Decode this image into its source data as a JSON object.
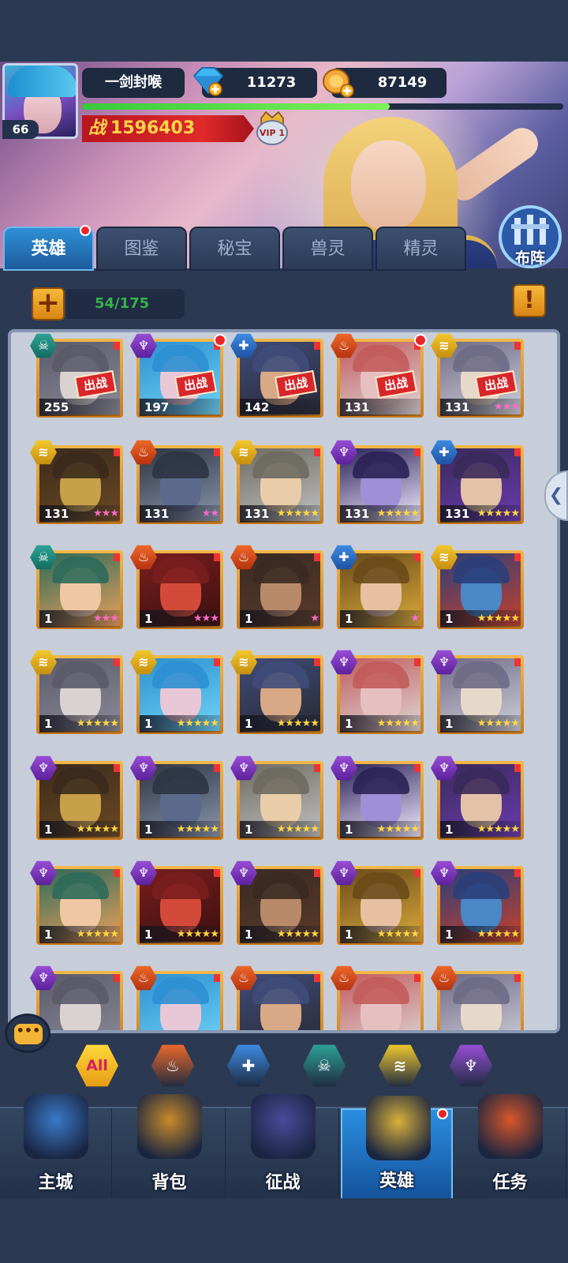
{
  "player": {
    "name": "一剑封喉",
    "level": "66",
    "gems": "11273",
    "gold": "87149",
    "power_prefix": "战",
    "power": "1596403",
    "vip": "VIP 1",
    "xp_fraction": 0.64
  },
  "formation_label": "布阵",
  "tabs": [
    {
      "label": "英雄",
      "active": true,
      "badge": true
    },
    {
      "label": "图鉴"
    },
    {
      "label": "秘宝"
    },
    {
      "label": "兽灵"
    },
    {
      "label": "精灵"
    }
  ],
  "roster": {
    "count": "54/175"
  },
  "deploy_label": "出战",
  "heroes": [
    {
      "element": "dark",
      "level": "255",
      "deployed": true,
      "stars": 0,
      "star_color": "pink",
      "dot": false
    },
    {
      "element": "purple",
      "level": "197",
      "deployed": true,
      "stars": 0,
      "star_color": "pink",
      "dot": true
    },
    {
      "element": "blue",
      "level": "142",
      "deployed": true,
      "stars": 0,
      "star_color": "pink",
      "dot": false
    },
    {
      "element": "fire",
      "level": "131",
      "deployed": true,
      "stars": 0,
      "star_color": "pink",
      "dot": true
    },
    {
      "element": "gold",
      "level": "131",
      "deployed": true,
      "stars": 3,
      "star_color": "pink",
      "dot": false
    },
    {
      "element": "gold",
      "level": "131",
      "deployed": false,
      "stars": 3,
      "star_color": "pink",
      "dot": false
    },
    {
      "element": "fire",
      "level": "131",
      "deployed": false,
      "stars": 2,
      "star_color": "pink",
      "dot": false
    },
    {
      "element": "gold",
      "level": "131",
      "deployed": false,
      "stars": 5,
      "star_color": "gold",
      "dot": false
    },
    {
      "element": "purple",
      "level": "131",
      "deployed": false,
      "stars": 5,
      "star_color": "gold",
      "dot": false
    },
    {
      "element": "blue",
      "level": "131",
      "deployed": false,
      "stars": 5,
      "star_color": "gold",
      "dot": false
    },
    {
      "element": "dark",
      "level": "1",
      "deployed": false,
      "stars": 3,
      "star_color": "pink",
      "dot": false
    },
    {
      "element": "fire",
      "level": "1",
      "deployed": false,
      "stars": 3,
      "star_color": "pink",
      "dot": false
    },
    {
      "element": "fire",
      "level": "1",
      "deployed": false,
      "stars": 1,
      "star_color": "pink",
      "dot": false
    },
    {
      "element": "blue",
      "level": "1",
      "deployed": false,
      "stars": 1,
      "star_color": "pink",
      "dot": false
    },
    {
      "element": "gold",
      "level": "1",
      "deployed": false,
      "stars": 5,
      "star_color": "gold",
      "dot": false
    },
    {
      "element": "gold",
      "level": "1",
      "deployed": false,
      "stars": 5,
      "star_color": "gold",
      "dot": false
    },
    {
      "element": "gold",
      "level": "1",
      "deployed": false,
      "stars": 5,
      "star_color": "gold",
      "dot": false
    },
    {
      "element": "gold",
      "level": "1",
      "deployed": false,
      "stars": 5,
      "star_color": "gold",
      "dot": false
    },
    {
      "element": "purple",
      "level": "1",
      "deployed": false,
      "stars": 5,
      "star_color": "gold",
      "dot": false
    },
    {
      "element": "purple",
      "level": "1",
      "deployed": false,
      "stars": 5,
      "star_color": "gold",
      "dot": false
    },
    {
      "element": "purple",
      "level": "1",
      "deployed": false,
      "stars": 5,
      "star_color": "gold",
      "dot": false
    },
    {
      "element": "purple",
      "level": "1",
      "deployed": false,
      "stars": 5,
      "star_color": "gold",
      "dot": false
    },
    {
      "element": "purple",
      "level": "1",
      "deployed": false,
      "stars": 5,
      "star_color": "gold",
      "dot": false
    },
    {
      "element": "purple",
      "level": "1",
      "deployed": false,
      "stars": 5,
      "star_color": "gold",
      "dot": false
    },
    {
      "element": "purple",
      "level": "1",
      "deployed": false,
      "stars": 5,
      "star_color": "gold",
      "dot": false
    },
    {
      "element": "purple",
      "level": "1",
      "deployed": false,
      "stars": 5,
      "star_color": "gold",
      "dot": false
    },
    {
      "element": "purple",
      "level": "1",
      "deployed": false,
      "stars": 5,
      "star_color": "gold",
      "dot": false
    },
    {
      "element": "purple",
      "level": "1",
      "deployed": false,
      "stars": 5,
      "star_color": "gold",
      "dot": false
    },
    {
      "element": "purple",
      "level": "1",
      "deployed": false,
      "stars": 5,
      "star_color": "gold",
      "dot": false
    },
    {
      "element": "purple",
      "level": "1",
      "deployed": false,
      "stars": 5,
      "star_color": "gold",
      "dot": false
    },
    {
      "element": "purple",
      "level": "",
      "deployed": false,
      "stars": 0,
      "star_color": "gold",
      "dot": false
    },
    {
      "element": "fire",
      "level": "",
      "deployed": false,
      "stars": 0,
      "star_color": "gold",
      "dot": false
    },
    {
      "element": "fire",
      "level": "",
      "deployed": false,
      "stars": 0,
      "star_color": "gold",
      "dot": false
    },
    {
      "element": "fire",
      "level": "",
      "deployed": false,
      "stars": 0,
      "star_color": "gold",
      "dot": false
    },
    {
      "element": "fire",
      "level": "",
      "deployed": false,
      "stars": 0,
      "star_color": "gold",
      "dot": false
    }
  ],
  "element_colors": {
    "dark": "#2ea59a",
    "purple": "#9b4fd8",
    "blue": "#3d8ee6",
    "fire": "#f06a2a",
    "gold": "#f5cb2e"
  },
  "filters": [
    {
      "label": "All",
      "icon": "all-filter-icon"
    },
    {
      "label": "",
      "icon": "fire-element-icon",
      "element": "fire"
    },
    {
      "label": "",
      "icon": "blue-cross-element-icon",
      "element": "blue"
    },
    {
      "label": "",
      "icon": "skull-element-icon",
      "element": "dark"
    },
    {
      "label": "",
      "icon": "wind-element-icon",
      "element": "gold"
    },
    {
      "label": "",
      "icon": "trident-element-icon",
      "element": "purple"
    }
  ],
  "nav": [
    {
      "label": "主城",
      "icon": "castle-icon"
    },
    {
      "label": "背包",
      "icon": "treasure-chest-icon"
    },
    {
      "label": "征战",
      "icon": "dragon-portal-icon"
    },
    {
      "label": "英雄",
      "icon": "hero-helmet-icon",
      "active": true,
      "badge": true
    },
    {
      "label": "任务",
      "icon": "scroll-icon"
    }
  ]
}
